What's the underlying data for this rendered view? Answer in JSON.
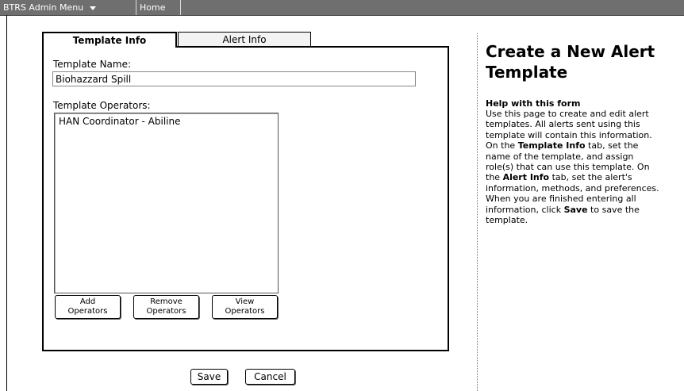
{
  "topbar": {
    "admin_menu_label": "BTRS Admin Menu",
    "home_label": "Home"
  },
  "tabs": [
    {
      "label": "Template Info",
      "active": true
    },
    {
      "label": "Alert Info",
      "active": false
    }
  ],
  "form": {
    "template_name_label": "Template Name:",
    "template_name_value": "Biohazzard Spill",
    "template_operators_label": "Template Operators:",
    "operators": [
      "HAN Coordinator - Abiline"
    ],
    "add_operators_label": [
      "Add",
      "Operators"
    ],
    "remove_operators_label": [
      "Remove",
      "Operators"
    ],
    "view_operators_label": [
      "View",
      "Operators"
    ]
  },
  "actions": {
    "save_label": "Save",
    "cancel_label": "Cancel"
  },
  "help": {
    "title": "Create a New Alert Template",
    "heading": "Help with this form",
    "lines": [
      [
        "Use this page to create and edit alert"
      ],
      [
        "templates. All alerts sent using this"
      ],
      [
        "template will contain this information."
      ],
      [
        "On the ",
        "Template Info",
        " tab, set the"
      ],
      [
        "name of the template, and assign"
      ],
      [
        "role(s) that can use this template. On"
      ],
      [
        "the ",
        "Alert Info",
        " tab, set the alert's"
      ],
      [
        "information, methods, and preferences."
      ],
      [
        "When you are finished entering all"
      ],
      [
        "information, click ",
        "Save",
        " to save the"
      ],
      [
        "template."
      ]
    ]
  }
}
